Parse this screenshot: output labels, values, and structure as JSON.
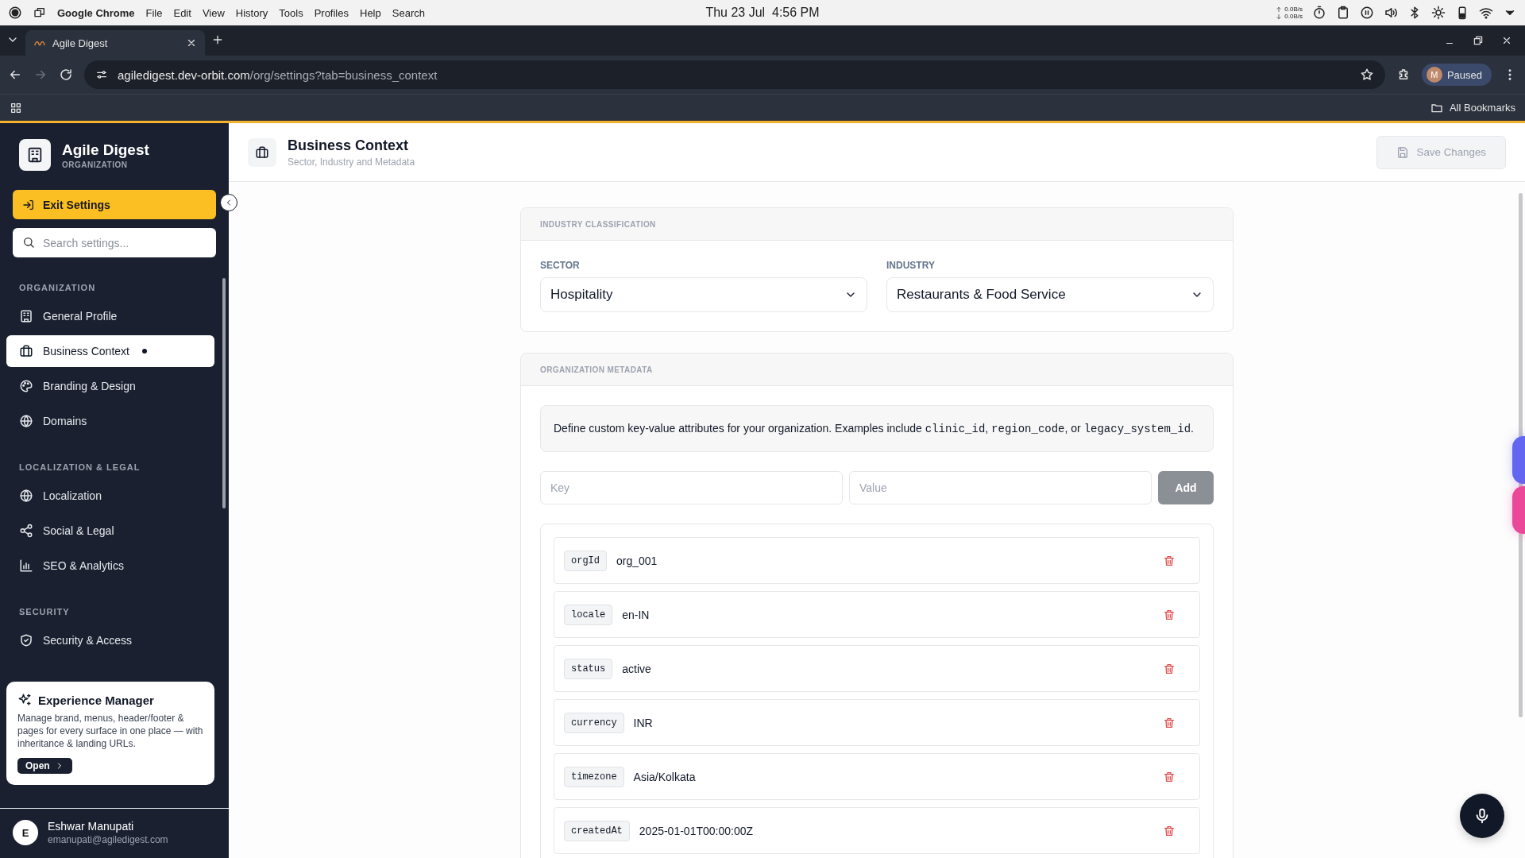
{
  "os_bar": {
    "app_name": "Google Chrome",
    "menus": [
      "File",
      "Edit",
      "View",
      "History",
      "Tools",
      "Profiles",
      "Help",
      "Search"
    ],
    "clock": "Thu 23 Jul  4:56 PM",
    "net_up": "0.0B/s",
    "net_down": "0.0B/s"
  },
  "browser": {
    "tab_title": "Agile Digest",
    "url_host": "agiledigest.dev-orbit.com",
    "url_path": "/org/settings?tab=business_context",
    "forward_disabled": true,
    "profile_initial": "M",
    "profile_label": "Paused",
    "bookmarks_label": "All Bookmarks"
  },
  "sidebar": {
    "brand": {
      "name": "Agile Digest",
      "subtitle": "ORGANIZATION"
    },
    "exit_button": "Exit Settings",
    "search": {
      "placeholder": "Search settings..."
    },
    "sections": [
      {
        "title": "ORGANIZATION",
        "items": [
          {
            "label": "General Profile",
            "selected": false,
            "modified": false
          },
          {
            "label": "Business Context",
            "selected": true,
            "modified": true
          },
          {
            "label": "Branding & Design",
            "selected": false,
            "modified": false
          },
          {
            "label": "Domains",
            "selected": false,
            "modified": false
          }
        ]
      },
      {
        "title": "LOCALIZATION & LEGAL",
        "items": [
          {
            "label": "Localization",
            "selected": false,
            "modified": false
          },
          {
            "label": "Social & Legal",
            "selected": false,
            "modified": false
          },
          {
            "label": "SEO & Analytics",
            "selected": false,
            "modified": false
          }
        ]
      },
      {
        "title": "SECURITY",
        "items": [
          {
            "label": "Security & Access",
            "selected": false,
            "modified": false
          }
        ]
      }
    ],
    "promo": {
      "title": "Experience Manager",
      "text": "Manage brand, menus, header/footer & pages for every surface in one place — with inheritance & landing URLs.",
      "button": "Open"
    },
    "user": {
      "initial": "E",
      "name": "Eshwar Manupati",
      "email": "emanupati@agiledigest.com"
    }
  },
  "header": {
    "title": "Business Context",
    "subtitle": "Sector, Industry and Metadata",
    "save_button": {
      "label": "Save Changes",
      "disabled": true
    }
  },
  "industry_card": {
    "title": "INDUSTRY CLASSIFICATION",
    "fields": [
      {
        "label": "SECTOR",
        "value": "Hospitality"
      },
      {
        "label": "INDUSTRY",
        "value": "Restaurants & Food Service"
      }
    ]
  },
  "metadata_card": {
    "title": "ORGANIZATION METADATA",
    "info": [
      {
        "kind": "text",
        "text": "Define custom key-value attributes for your organization. Examples include "
      },
      {
        "kind": "code",
        "text": "clinic_id"
      },
      {
        "kind": "text",
        "text": ", "
      },
      {
        "kind": "code",
        "text": "region_code"
      },
      {
        "kind": "text",
        "text": ", or "
      },
      {
        "kind": "code",
        "text": "legacy_system_id"
      },
      {
        "kind": "text",
        "text": "."
      }
    ],
    "key_placeholder": "Key",
    "value_placeholder": "Value",
    "add_button": {
      "label": "Add",
      "disabled": true
    },
    "entries": [
      {
        "key": "orgId",
        "value": "org_001"
      },
      {
        "key": "locale",
        "value": "en-IN"
      },
      {
        "key": "status",
        "value": "active"
      },
      {
        "key": "currency",
        "value": "INR"
      },
      {
        "key": "timezone",
        "value": "Asia/Kolkata"
      },
      {
        "key": "createdAt",
        "value": "2025-01-01T00:00:00Z"
      }
    ]
  }
}
